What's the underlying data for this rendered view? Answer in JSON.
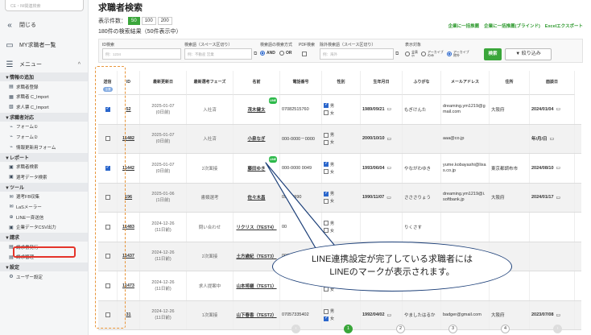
{
  "sidebar": {
    "search_placeholder": "CE・IM関連検索",
    "close_label": "閉じる",
    "top_list_label": "MY求職者一覧",
    "menu_label": "メニュー",
    "sections": [
      {
        "title": "▼情報の追加",
        "items": [
          {
            "label": "求職者登録"
          },
          {
            "label": "求職者 C_Import"
          },
          {
            "label": "求人票 C_Import"
          }
        ]
      },
      {
        "title": "▼求職者対応",
        "items": [
          {
            "label": "フォーム①"
          },
          {
            "label": "フォーム②"
          },
          {
            "label": "情報更新用フォーム"
          }
        ]
      },
      {
        "title": "▼レポート",
        "items": [
          {
            "label": "求職者検索"
          },
          {
            "label": "選考データ検索"
          }
        ]
      },
      {
        "title": "▼ツール",
        "items": [
          {
            "label": "選考FB収集"
          },
          {
            "label": "LaSメーラー"
          },
          {
            "label": "LINE一斉送信"
          },
          {
            "label": "企業データCSV出力"
          }
        ]
      },
      {
        "title": "▼請求",
        "items": [
          {
            "label": "請求書発行"
          },
          {
            "label": "請求管理"
          }
        ]
      },
      {
        "title": "▼設定",
        "items": [
          {
            "label": "ユーザー設定"
          }
        ]
      }
    ]
  },
  "page": {
    "title": "求職者検索",
    "count_label": "表示件数：",
    "page_sizes": [
      "50",
      "100",
      "200"
    ],
    "result_text": "180件の検索結果（50件表示中）",
    "links": [
      "企業に一括推薦",
      "企業に一括推薦(ブラインド)",
      "Excelエクスポート"
    ]
  },
  "filter": {
    "id_label": "ID検索",
    "id_placeholder": "例：1234",
    "free_label": "検索語（スペース区切り）",
    "free_placeholder": "例：不動産 営業",
    "method_label": "検索語の検索方式",
    "and_label": "AND",
    "or_label": "OR",
    "pdf_label": "PDF検索",
    "exclude_label": "除外検索語（スペース区切り）",
    "exclude_placeholder": "例：海外",
    "target_label": "表示対象",
    "target_opts": [
      "全表示",
      "アーカイブのみ",
      "アーカイブ除外"
    ],
    "search_btn": "検索",
    "narrow_btn": "▼ 絞り込み"
  },
  "table": {
    "headers": [
      "送信",
      "ID",
      "最新更新日",
      "最新選考フェーズ",
      "名前",
      "電話番号",
      "性別",
      "生年月日",
      "ふりがな",
      "メールアドレス",
      "住所",
      "面談日"
    ],
    "send_badge": "全選",
    "line_badge": "LINE",
    "male": "男",
    "female": "女",
    "rows": [
      {
        "checked": true,
        "id": "52",
        "date": "2025-01-07",
        "ago": "(0日前)",
        "phase": "入社済",
        "name": "茂木健太",
        "line": true,
        "phone": "07082515760",
        "male": true,
        "female": false,
        "birth": "1989/09/21",
        "kana": "もぎけんた",
        "email": "dreaming.ym1219@gmail.com",
        "addr": "大阪府",
        "meet": "2024/01/04"
      },
      {
        "checked": false,
        "id": "11482",
        "date": "2025-01-07",
        "ago": "(0日前)",
        "phase": "入社済",
        "name": "小泉なぎ",
        "line": false,
        "phone": "000-0000－0000",
        "male": false,
        "female": false,
        "birth": "2000/10/10",
        "kana": "",
        "email": "aaa@co.jp",
        "addr": "",
        "meet": "年/月/日"
      },
      {
        "checked": true,
        "id": "11442",
        "date": "2025-01-07",
        "ago": "(0日前)",
        "phase": "2次面接",
        "name": "藤田ゆき",
        "line": true,
        "phone": "000-0000 0049",
        "male": true,
        "female": false,
        "birth": "1993/06/04",
        "kana": "やながわゆき",
        "email": "yume.kobayashi@lixas.co.jp",
        "addr": "東京都調布市",
        "meet": "2024/08/10"
      },
      {
        "checked": false,
        "id": "196",
        "date": "2025-01-06",
        "ago": "(1日前)",
        "phase": "書類選考",
        "name": "佐々木昌",
        "line": false,
        "phone": "09099990",
        "male": true,
        "female": false,
        "birth": "1990/11/07",
        "kana": "さささりょう",
        "email": "dreaming.ym1219@i.softbank.jp",
        "addr": "大阪府",
        "meet": "2024/01/17"
      },
      {
        "checked": false,
        "id": "11483",
        "date": "2024-12-26",
        "ago": "(11日前)",
        "phase": "問い合わせ",
        "name": "リクリス（TEST4）",
        "line": false,
        "phone": "00",
        "male": false,
        "female": false,
        "birth": "",
        "kana": "りくさす",
        "email": "",
        "addr": "",
        "meet": ""
      },
      {
        "checked": false,
        "id": "11437",
        "date": "2024-12-26",
        "ago": "(11日前)",
        "phase": "2次面接",
        "name": "土方歳紀（TEST3）",
        "line": false,
        "phone": "000-0000 0044",
        "male": false,
        "female": false,
        "birth": "",
        "kana": "",
        "email": "",
        "addr": "",
        "meet": ""
      },
      {
        "checked": false,
        "id": "11473",
        "date": "2024-12-26",
        "ago": "(11日前)",
        "phase": "求人提案中",
        "name": "山本将継（TEST1）",
        "line": false,
        "phone": "",
        "male": false,
        "female": false,
        "birth": "",
        "kana": "",
        "email": "",
        "addr": "",
        "meet": ""
      },
      {
        "checked": false,
        "id": "31",
        "date": "2024-12-26",
        "ago": "(11日前)",
        "phase": "1次面接",
        "name": "山下春香（TEST2）",
        "line": false,
        "phone": "07057335402",
        "male": false,
        "female": true,
        "birth": "1992/04/02",
        "kana": "やましたはるか",
        "email": "badger@gmail.com",
        "addr": "大阪府",
        "meet": "2023/07/08"
      }
    ]
  },
  "callout": {
    "line1": "LINE連携設定が完了している求職者には",
    "line2": "LINEのマークが表示されます。"
  },
  "pager": {
    "pages": [
      "1",
      "2",
      "3",
      "4"
    ],
    "prev": "‹",
    "next": "›"
  }
}
